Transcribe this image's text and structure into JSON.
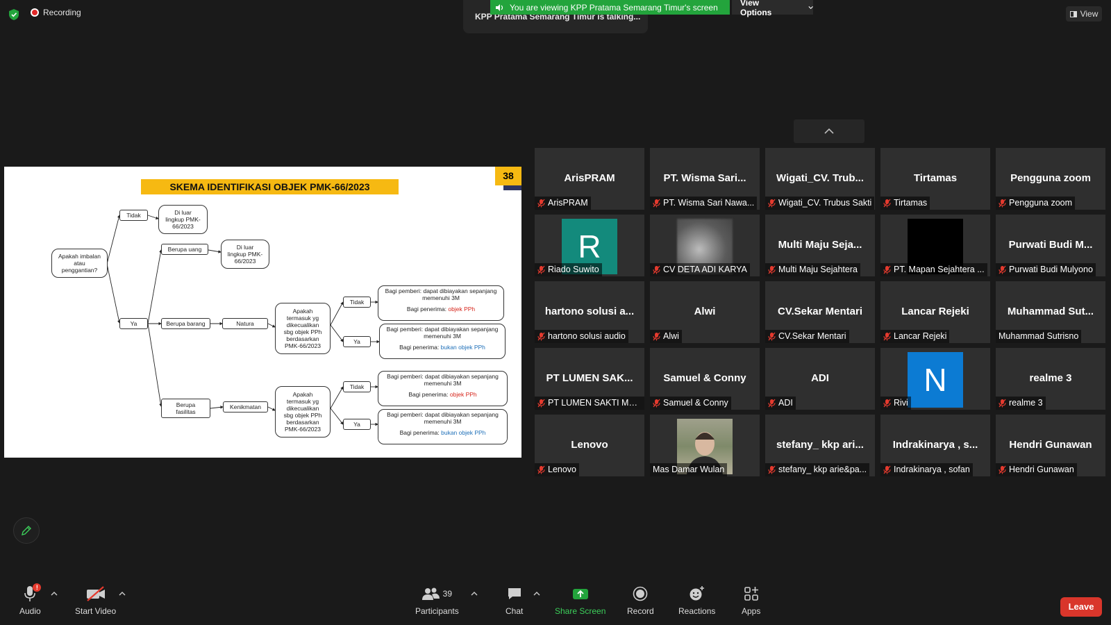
{
  "topbar": {
    "recording_label": "Recording",
    "talking_label": "KPP Pratama Semarang Timur is talking...",
    "viewing_label": "You are viewing KPP Pratama Semarang Timur's screen",
    "view_options_label": "View Options",
    "view_button_label": "View"
  },
  "slide": {
    "title": "SKEMA IDENTIFIKASI OBJEK PMK-66/2023",
    "page_number": "38",
    "nodes": {
      "imbalan": [
        "Apakah imbalan",
        "atau",
        "penggantian?"
      ],
      "tidak_top": "Tidak",
      "ya_main": "Ya",
      "luar1": [
        "Di luar",
        "lingkup PMK-",
        "66/2023"
      ],
      "berupa_uang": "Berupa uang",
      "luar2": [
        "Di luar",
        "lingkup PMK-",
        "66/2023"
      ],
      "berupa_barang": "Berupa barang",
      "natura": "Natura",
      "berupa_fasilitas": [
        "Berupa",
        "fasilitas"
      ],
      "kenikmatan": "Kenikmatan",
      "apakah1": [
        "Apakah",
        "termasuk yg",
        "dikecualikan",
        "sbg objek PPh",
        "berdasarkan",
        "PMK-66/2023"
      ],
      "apakah2": [
        "Apakah",
        "termasuk yg",
        "dikecualikan",
        "sbg objek PPh",
        "berdasarkan",
        "PMK-66/2023"
      ],
      "tidak1": "Tidak",
      "ya1": "Ya",
      "tidak2": "Tidak",
      "ya2": "Ya",
      "pemberi_line1": "Bagi pemberi: dapat dibiayakan sepanjang",
      "pemberi_line2": "memenuhi 3M",
      "penerima_prefix": "Bagi penerima: ",
      "objek": "objek PPh",
      "bukan_objek": "bukan objek PPh"
    }
  },
  "participants": [
    {
      "name": "ArisPRAM",
      "label": "ArisPRAM",
      "muted": true
    },
    {
      "name": "PT. Wisma Sari...",
      "label": "PT. Wisma Sari Nawa...",
      "muted": true
    },
    {
      "name": "Wigati_CV. Trub...",
      "label": "Wigati_CV. Trubus Sakti",
      "muted": true
    },
    {
      "name": "Tirtamas",
      "label": "Tirtamas",
      "muted": true
    },
    {
      "name": "Pengguna zoom",
      "label": "Pengguna zoom",
      "muted": true
    },
    {
      "name": "R",
      "label": "Riado Suwito",
      "muted": true
    },
    {
      "name": "",
      "label": "CV DETA ADI KARYA",
      "muted": true
    },
    {
      "name": "Multi Maju Seja...",
      "label": "Multi Maju Sejahtera",
      "muted": true
    },
    {
      "name": "",
      "label": "PT. Mapan Sejahtera ...",
      "muted": true
    },
    {
      "name": "Purwati Budi M...",
      "label": "Purwati Budi Mulyono",
      "muted": true
    },
    {
      "name": "hartono solusi a...",
      "label": "hartono solusi audio",
      "muted": true
    },
    {
      "name": "Alwi",
      "label": "Alwi",
      "muted": true
    },
    {
      "name": "CV.Sekar Mentari",
      "label": "CV.Sekar Mentari",
      "muted": true
    },
    {
      "name": "Lancar Rejeki",
      "label": "Lancar Rejeki",
      "muted": true
    },
    {
      "name": "Muhammad Sut...",
      "label": "Muhammad Sutrisno",
      "muted": false
    },
    {
      "name": "PT LUMEN SAK...",
      "label": "PT LUMEN SAKTI MA...",
      "muted": true
    },
    {
      "name": "Samuel & Conny",
      "label": "Samuel & Conny",
      "muted": true
    },
    {
      "name": "ADI",
      "label": "ADI",
      "muted": true
    },
    {
      "name": "N",
      "label": "Rivi",
      "muted": true
    },
    {
      "name": "realme 3",
      "label": "realme 3",
      "muted": true
    },
    {
      "name": "Lenovo",
      "label": "Lenovo",
      "muted": true
    },
    {
      "name": "",
      "label": "Mas Damar Wulan",
      "muted": false
    },
    {
      "name": "stefany_ kkp ari...",
      "label": "stefany_ kkp arie&pa...",
      "muted": true
    },
    {
      "name": "Indrakinarya , s...",
      "label": "Indrakinarya , sofan",
      "muted": true
    },
    {
      "name": "Hendri Gunawan",
      "label": "Hendri Gunawan",
      "muted": true
    }
  ],
  "colors": {
    "avatar_R": "#138a7c",
    "avatar_N": "#0c7bd3",
    "accent_green": "#23a43c",
    "leave_red": "#d9362b",
    "slide_yellow": "#f6b912"
  },
  "toolbar": {
    "audio": "Audio",
    "audio_badge": "!",
    "video": "Start Video",
    "participants": "Participants",
    "participants_count": "39",
    "chat": "Chat",
    "share": "Share Screen",
    "record": "Record",
    "reactions": "Reactions",
    "apps": "Apps",
    "leave": "Leave"
  }
}
